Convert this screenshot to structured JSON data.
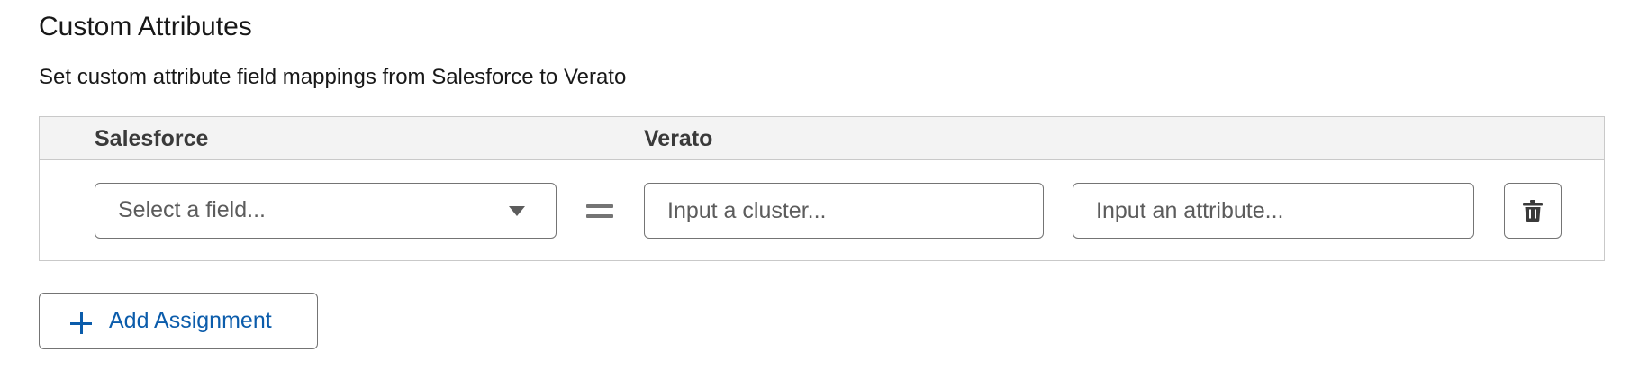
{
  "section": {
    "title": "Custom Attributes",
    "subtitle": "Set custom attribute field mappings from Salesforce to Verato"
  },
  "table": {
    "columns": {
      "salesforce": "Salesforce",
      "verato": "Verato"
    },
    "rows": [
      {
        "field_select": {
          "placeholder": "Select a field...",
          "value": ""
        },
        "cluster_input": {
          "placeholder": "Input a cluster...",
          "value": ""
        },
        "attribute_input": {
          "placeholder": "Input an attribute...",
          "value": ""
        }
      }
    ]
  },
  "actions": {
    "add_assignment_label": "Add Assignment"
  },
  "icons": {
    "select_caret": "chevron-down-icon",
    "equals": "equals-icon",
    "delete": "trash-icon",
    "add": "plus-icon"
  },
  "colors": {
    "border": "#747474",
    "header_bg": "#f3f3f3",
    "table_border": "#c9c9c9",
    "brand_link": "#0b5cab",
    "placeholder": "#5c5c5c"
  }
}
